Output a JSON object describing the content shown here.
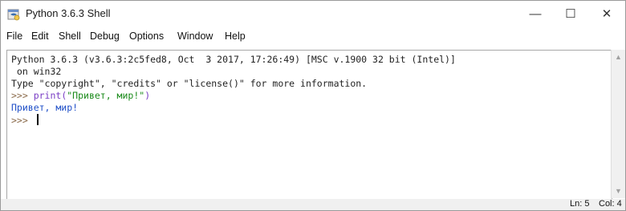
{
  "window": {
    "title": "Python 3.6.3 Shell",
    "controls": {
      "minimize": "—",
      "maximize": "☐",
      "close": "✕"
    },
    "icon": "python-shell-icon"
  },
  "menu": [
    "File",
    "Edit",
    "Shell",
    "Debug",
    "Options",
    "Window",
    "Help"
  ],
  "shell": {
    "banner_line1": "Python 3.6.3 (v3.6.3:2c5fed8, Oct  3 2017, 17:26:49) [MSC v.1900 32 bit (Intel)]",
    "banner_line2": " on win32",
    "banner_line3": "Type \"copyright\", \"credits\" or \"license()\" for more information.",
    "prompt": ">>> ",
    "cmd_fn": "print(",
    "cmd_str": "\"Привет, мир!\"",
    "cmd_close": ")",
    "output": "Привет, мир!"
  },
  "status": {
    "line": "Ln: 5",
    "col": "Col: 4"
  },
  "colors": {
    "prompt": "#8a6a4a",
    "builtin": "#7a3ec5",
    "string": "#1a8a1a",
    "output": "#2050c8"
  }
}
